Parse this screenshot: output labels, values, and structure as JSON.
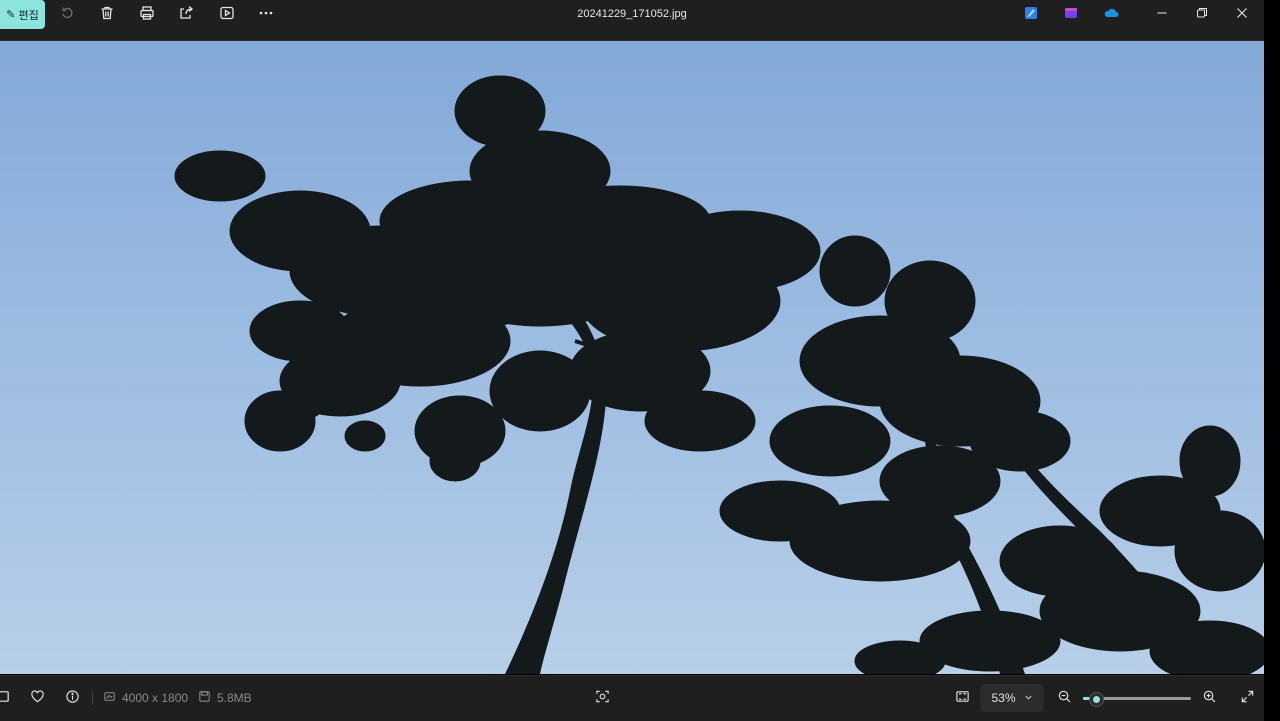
{
  "toolbar": {
    "edit_label": "편집",
    "icons": [
      "edit-icon",
      "rotate-icon",
      "delete-icon",
      "print-icon",
      "share-icon",
      "slideshow-icon",
      "more-icon"
    ]
  },
  "window": {
    "title": "20241229_171052.jpg",
    "app_icons": [
      "designer-icon",
      "clipchamp-icon",
      "onedrive-icon"
    ],
    "controls": [
      "minimize-icon",
      "restore-icon",
      "close-icon"
    ]
  },
  "image": {
    "subject": "pine trees silhouetted against evening sky"
  },
  "statusbar": {
    "dimensions": "4000 x 1800",
    "file_size": "5.8MB",
    "zoom_label": "53%",
    "zoom_fraction": 0.12
  },
  "colors": {
    "accent": "#8de4dc",
    "toolbar_bg": "#1f1f1f",
    "sky_top": "#83a9d8",
    "sky_bottom": "#b7cfe9",
    "tree": "#141a1c"
  }
}
